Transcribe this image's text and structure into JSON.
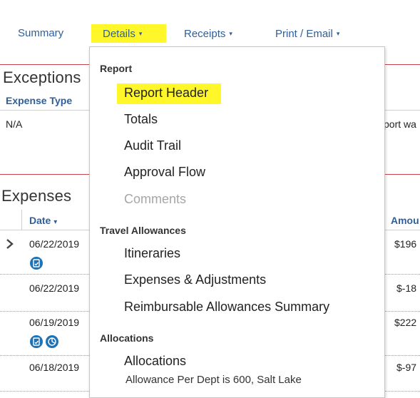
{
  "nav": {
    "tabs": [
      {
        "label": "Summary"
      },
      {
        "label": "Details",
        "caret": "▾"
      },
      {
        "label": "Receipts",
        "caret": "▾"
      },
      {
        "label": "Print / Email",
        "caret": "▾"
      }
    ]
  },
  "exceptions": {
    "title": "Exceptions",
    "column_expense_type": "Expense Type",
    "row_value": "N/A",
    "row_message_partial": "port wa"
  },
  "expenses": {
    "title": "Expenses",
    "column_date": "Date",
    "column_date_sort": "▾",
    "column_amount": "Amou",
    "rows": [
      {
        "date": "06/22/2019",
        "amount": "$196"
      },
      {
        "date": "06/22/2019",
        "amount": "$-18"
      },
      {
        "date": "06/19/2019",
        "amount": "$222"
      },
      {
        "date": "06/18/2019",
        "amount": "$-97"
      }
    ],
    "expand_icon": "chevron-right-icon"
  },
  "details_menu": {
    "groups": [
      {
        "label": "Report",
        "items": [
          {
            "label": "Report Header",
            "highlighted": true
          },
          {
            "label": "Totals"
          },
          {
            "label": "Audit Trail"
          },
          {
            "label": "Approval Flow"
          },
          {
            "label": "Comments",
            "disabled": true
          }
        ]
      },
      {
        "label": "Travel Allowances",
        "items": [
          {
            "label": "Itineraries"
          },
          {
            "label": "Expenses & Adjustments"
          },
          {
            "label": "Reimbursable Allowances Summary"
          }
        ]
      },
      {
        "label": "Allocations",
        "items": [
          {
            "label": "Allocations"
          }
        ]
      }
    ],
    "cut_off_text": "Allowance Per Dept is 600, Salt Lake"
  },
  "colors": {
    "link_blue": "#2f5f9a",
    "highlight_yellow": "#fff72a",
    "section_red": "#c8444c",
    "icon_blue": "#1d73b6"
  }
}
